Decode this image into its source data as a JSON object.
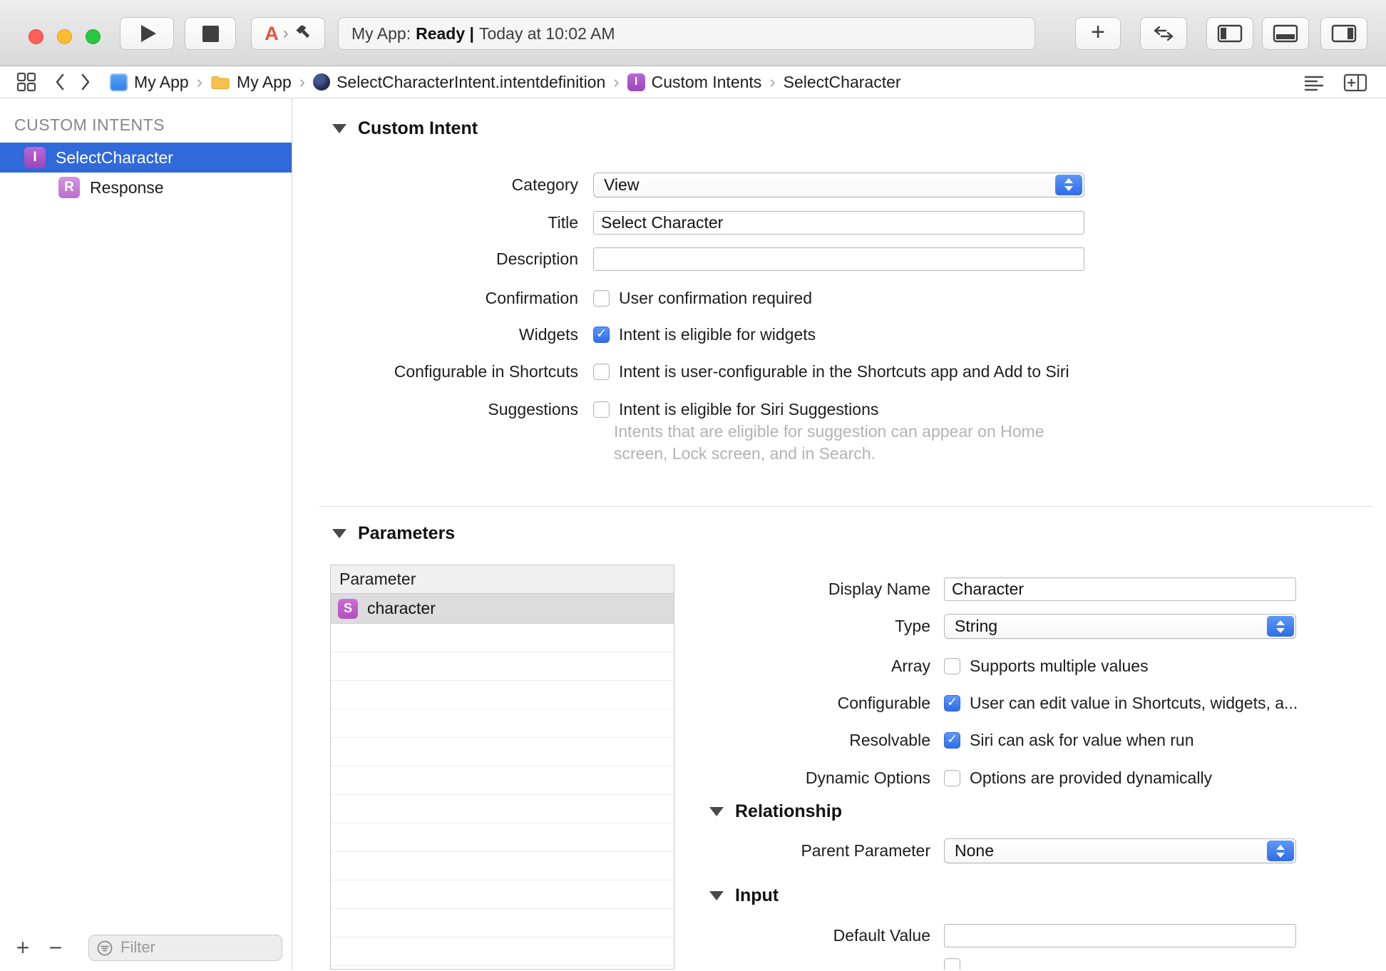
{
  "colors": {
    "accent_blue": "#3574F0",
    "selection_blue": "#3069D9",
    "intent_purple": "#A553C9",
    "response_purple": "#C583D8",
    "parameter_purple": "#C05FC9",
    "toolbar_gray": "#E8E8E8"
  },
  "toolbar": {
    "add_label": "+",
    "status": {
      "project": "My App:",
      "state": "Ready |",
      "time": "Today at 10:02 AM"
    }
  },
  "jumpbar": {
    "separator": "›",
    "crumbs": [
      {
        "label": "My App"
      },
      {
        "label": "My App"
      },
      {
        "label": "SelectCharacterIntent.intentdefinition"
      },
      {
        "label": "Custom Intents",
        "badge": "I"
      },
      {
        "label": "SelectCharacter"
      }
    ]
  },
  "sidebar": {
    "header": "CUSTOM INTENTS",
    "items": [
      {
        "badge": "I",
        "label": "SelectCharacter"
      },
      {
        "badge": "R",
        "label": "Response"
      }
    ],
    "add_label": "+",
    "remove_label": "−",
    "filter_placeholder": "Filter"
  },
  "custom_intent": {
    "title": "Custom Intent",
    "category": {
      "label": "Category",
      "value": "View"
    },
    "title_field": {
      "label": "Title",
      "value": "Select Character"
    },
    "description": {
      "label": "Description",
      "value": ""
    },
    "confirmation": {
      "label": "Confirmation",
      "text": "User confirmation required",
      "checked": false
    },
    "widgets": {
      "label": "Widgets",
      "text": "Intent is eligible for widgets",
      "checked": true
    },
    "shortcuts": {
      "label": "Configurable in Shortcuts",
      "text": "Intent is user-configurable in the Shortcuts app and Add to Siri",
      "checked": false
    },
    "suggestions": {
      "label": "Suggestions",
      "text": "Intent is eligible for Siri Suggestions",
      "checked": false
    },
    "suggestions_help": "Intents that are eligible for suggestion can appear on Home screen, Lock screen, and in Search."
  },
  "parameters": {
    "title": "Parameters",
    "table": {
      "header": "Parameter",
      "rows": [
        {
          "badge": "S",
          "name": "character"
        }
      ]
    },
    "display_name": {
      "label": "Display Name",
      "value": "Character"
    },
    "type": {
      "label": "Type",
      "value": "String"
    },
    "array": {
      "label": "Array",
      "text": "Supports multiple values",
      "checked": false
    },
    "configurable": {
      "label": "Configurable",
      "text": "User can edit value in Shortcuts, widgets, a...",
      "checked": true
    },
    "resolvable": {
      "label": "Resolvable",
      "text": "Siri can ask for value when run",
      "checked": true
    },
    "dynamic_options": {
      "label": "Dynamic Options",
      "text": "Options are provided dynamically",
      "checked": false
    }
  },
  "relationship": {
    "title": "Relationship",
    "parent_parameter": {
      "label": "Parent Parameter",
      "value": "None"
    }
  },
  "input_section": {
    "title": "Input",
    "default_value": {
      "label": "Default Value",
      "value": ""
    }
  }
}
